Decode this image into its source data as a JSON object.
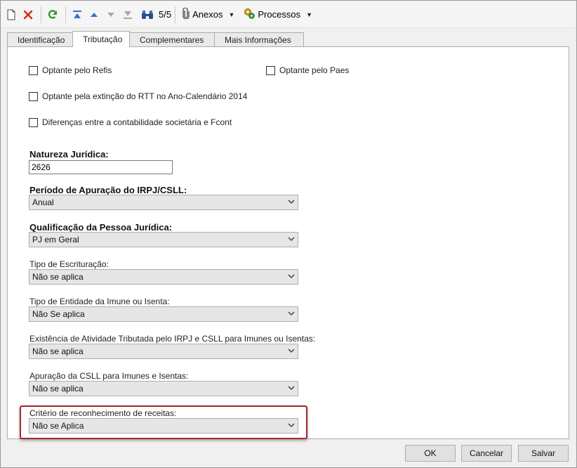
{
  "toolbar": {
    "record_counter": "5/5",
    "anexos_label": "Anexos",
    "processos_label": "Processos"
  },
  "tabs": [
    {
      "label": "Identificação"
    },
    {
      "label": "Tributação"
    },
    {
      "label": "Complementares"
    },
    {
      "label": "Mais Informações"
    }
  ],
  "checkboxes": {
    "refis": {
      "label": "Optante pelo Refis",
      "checked": false
    },
    "paes": {
      "label": "Optante pelo Paes",
      "checked": false
    },
    "rtt": {
      "label": "Optante pela extinção do RTT no Ano-Calendário 2014",
      "checked": false
    },
    "fcont": {
      "label": "Diferenças entre a contabilidade societária e Fcont",
      "checked": false
    }
  },
  "fields": {
    "natureza": {
      "label": "Natureza Jurídica:",
      "value": "2626"
    },
    "periodo": {
      "label": "Período de Apuração do IRPJ/CSLL:",
      "value": "Anual"
    },
    "qualificacao": {
      "label": "Qualificação da Pessoa Jurídica:",
      "value": "PJ em Geral"
    },
    "escrituracao": {
      "label": "Tipo de Escrituração:",
      "value": "Não se aplica"
    },
    "entidade": {
      "label": "Tipo de Entidade da Imune ou Isenta:",
      "value": "Não Se aplica"
    },
    "existencia": {
      "label": "Existência de Atividade Tributada pelo IRPJ e CSLL para Imunes ou Isentas:",
      "value": "Não se aplica"
    },
    "apuracao_csll": {
      "label": "Apuração da CSLL para Imunes e Isentas:",
      "value": "Não se aplica"
    },
    "criterio": {
      "label": "Critério de reconhecimento de receitas:",
      "value": "Não se Aplica"
    }
  },
  "buttons": {
    "ok": "OK",
    "cancel": "Cancelar",
    "save": "Salvar"
  },
  "colors": {
    "highlight_border": "#a8262f",
    "delete_red": "#d9261c",
    "refresh_green": "#2e9a2e",
    "nav_blue": "#3a6ecf"
  }
}
